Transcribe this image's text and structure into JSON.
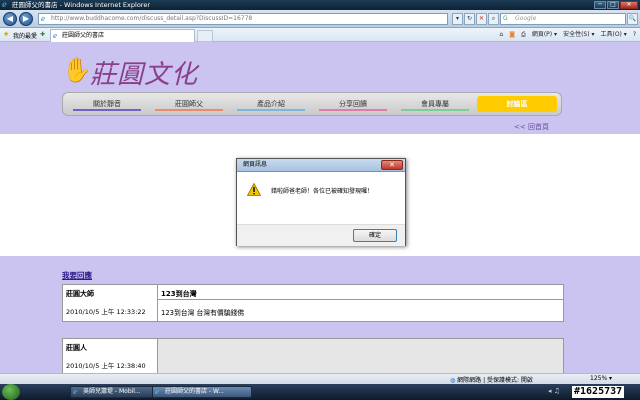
{
  "window": {
    "title": "莊圓師父的書店 - Windows Internet Explorer",
    "minimize": "─",
    "maximize": "□",
    "close": "✕"
  },
  "browser": {
    "back": "◀",
    "forward": "▶",
    "url": "http://www.buddhacome.com/discuss_detail.asp?DiscussID=16778",
    "search_placeholder": "Google",
    "search_go": "🔍",
    "favorites_label": "我的最愛",
    "tab_title": "莊圓師父的書店",
    "commands": [
      "網頁(P) ▾",
      "安全性(S) ▾",
      "工具(O) ▾",
      "?"
    ]
  },
  "site": {
    "logo_text": "莊圓文化",
    "nav": [
      {
        "label": "關於靜音",
        "color": "#6d63c9"
      },
      {
        "label": "莊圓師父",
        "color": "#e88c6c"
      },
      {
        "label": "產品介紹",
        "color": "#7bb7e0"
      },
      {
        "label": "分享回饋",
        "color": "#e07bb0"
      },
      {
        "label": "會員專屬",
        "color": "#7ccf9a"
      },
      {
        "label": "討論區",
        "color": "#ffcc00"
      }
    ],
    "back_link": "<< 回首頁"
  },
  "discussion": {
    "reply_link": "我要回應",
    "posts": [
      {
        "author": "莊圓大師",
        "time": "2010/10/5 上午 12:33:22",
        "title": "123到台灣",
        "content": "123到台灣 台灣有價騙錢佛"
      },
      {
        "author": "莊圓人",
        "time": "2010/10/5 上午 12:38:40",
        "title": "",
        "content": ""
      }
    ]
  },
  "dialog": {
    "title": "網頁訊息",
    "close": "✕",
    "message": "錯啦師爸老師！各位已被確知發現囉！",
    "ok_label": "確定"
  },
  "statusbar": {
    "zone": "網際網路 | 受保護模式: 開啟",
    "zoom": "125% ▾"
  },
  "taskbar": {
    "tasks": [
      "吳師兒蕭堤 - Mobil...",
      "莊圓師父的書店 - W..."
    ],
    "watermark": "#1625737"
  }
}
